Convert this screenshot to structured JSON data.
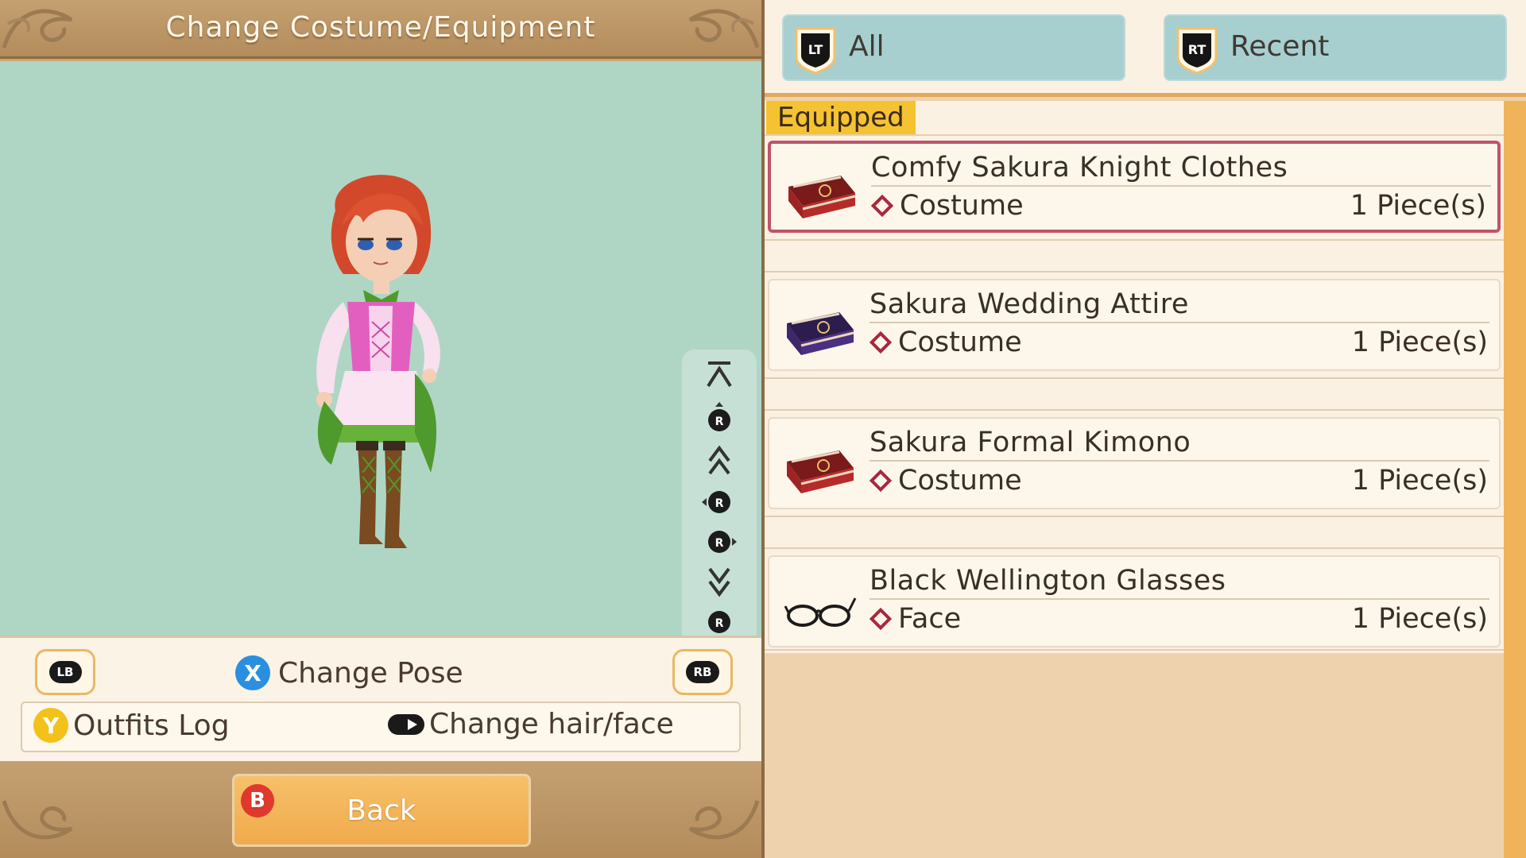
{
  "header": {
    "title": "Change Costume/Equipment"
  },
  "controls": {
    "lb_label": "LB",
    "rb_label": "RB",
    "x_button": "X",
    "change_pose_label": "Change Pose",
    "y_button": "Y",
    "outfits_log_label": "Outfits Log",
    "change_hair_face_label": "Change hair/face"
  },
  "camera_controls": {
    "button_letter": "R",
    "icons": [
      "zoom-max-icon",
      "camera-up-icon",
      "zoom-in-icon",
      "rotate-left-icon",
      "rotate-right-icon",
      "zoom-out-icon",
      "camera-down-icon",
      "zoom-min-icon"
    ]
  },
  "footer": {
    "b_button": "B",
    "back_label": "Back"
  },
  "tabs": [
    {
      "trigger": "LT",
      "label": "All"
    },
    {
      "trigger": "RT",
      "label": "Recent"
    }
  ],
  "list": {
    "section_label": "Equipped",
    "items": [
      {
        "name": "Comfy Sakura Knight Clothes",
        "category": "Costume",
        "quantity": "1 Piece(s)",
        "icon": "red-costume-case-icon",
        "selected": true
      },
      {
        "name": "Sakura Wedding Attire",
        "category": "Costume",
        "quantity": "1 Piece(s)",
        "icon": "purple-costume-case-icon",
        "selected": false
      },
      {
        "name": "Sakura Formal Kimono",
        "category": "Costume",
        "quantity": "1 Piece(s)",
        "icon": "red-costume-case-icon",
        "selected": false
      },
      {
        "name": "Black Wellington Glasses",
        "category": "Face",
        "quantity": "1 Piece(s)",
        "icon": "glasses-icon",
        "selected": false
      }
    ]
  },
  "colors": {
    "accent_gold": "#f5c232",
    "selected_border": "#c1526b",
    "preview_bg": "#afd6c4",
    "tab_bg": "#a8cfcf",
    "back_button": "#f0ab4c"
  }
}
